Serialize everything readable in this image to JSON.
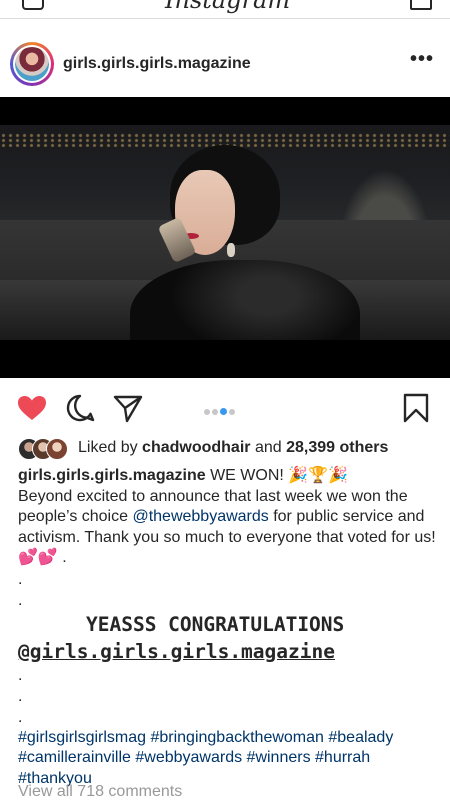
{
  "app": {
    "title": "Instagram"
  },
  "post": {
    "username": "girls.girls.girls.magazine",
    "more_glyph": "•••",
    "carousel": {
      "count": 4,
      "active_index": 2
    },
    "likes": {
      "prefix": "Liked by ",
      "liker": "chadwoodhair",
      "middle": " and ",
      "others": "28,399 others"
    },
    "caption": {
      "username": "girls.girls.girls.magazine",
      "line1_text": " WE WON! 🎉🏆🎉",
      "line2_a": "Beyond excited to announce that last week we won the people’s choice ",
      "mention": "@thewebbyawards",
      "line2_b": " for public service and activism. Thank you so much to everyone that voted for us! 💕💕 .",
      "dots_a": [
        ".",
        "."
      ],
      "big_line1": "YEASSS CONGRATULATIONS",
      "big_line2": "@girls.girls.girls.magazine",
      "dots_b": [
        ".",
        ".",
        "."
      ],
      "hashtags": "#girlsgirlsgirlsmag #bringingbackthewoman #bealady #camillerainville #webbyawards #winners #hurrah #thankyou"
    },
    "view_comments": "View all 718 comments"
  },
  "colors": {
    "heart": "#ed4956",
    "link": "#003569",
    "dot_active": "#3897f0"
  },
  "icons": {
    "heart": "heart-filled-icon",
    "comment": "comment-bubble-icon",
    "share": "paper-plane-icon",
    "save": "bookmark-icon",
    "more": "more-horizontal-icon"
  }
}
